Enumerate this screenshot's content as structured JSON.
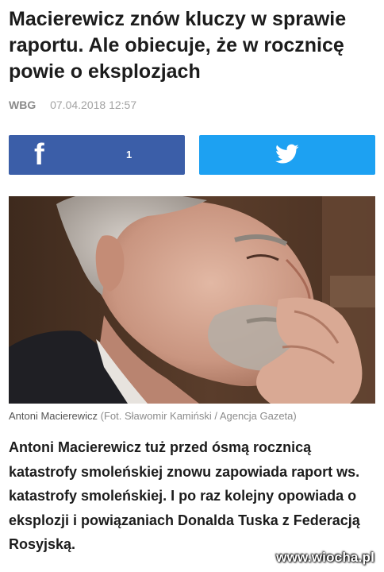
{
  "article": {
    "title": "Macierewicz znów kluczy w sprawie raportu. Ale obiecuje, że w rocznicę powie o eksplozjach",
    "author": "WBG",
    "date": "07.04.2018 12:57"
  },
  "share": {
    "facebook_icon": "f",
    "facebook_count": "1",
    "twitter_icon": "twitter-bird-icon"
  },
  "photo": {
    "caption_name": "Antoni Macierewicz",
    "caption_credit": "(Fot. Sławomir Kamiński / Agencja Gazeta)"
  },
  "lead": "Antoni Macierewicz tuż przed ósmą rocznicą katastrofy smoleńskiej znowu zapowiada raport ws. katastrofy smoleńskiej. I po raz kolejny opowiada o eksplozji i powiązaniach Donalda Tuska z Federacją Rosyjską.",
  "watermark": "www.wiocha.pl",
  "colors": {
    "facebook": "#3b5ea8",
    "twitter": "#1da1f2"
  }
}
